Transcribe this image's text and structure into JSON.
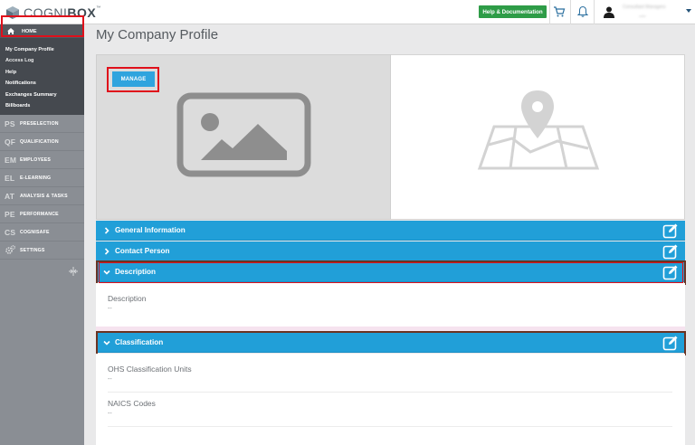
{
  "header": {
    "logo_prefix": "COGNI",
    "logo_suffix": "BOX",
    "logo_tm": "™",
    "help_label": "Help & Documentation",
    "icons": [
      "cart-icon",
      "bell-icon",
      "user-avatar-icon",
      "caret-down-icon"
    ],
    "user_name_blurred": "Consultant Managers",
    "user_sub_blurred": "user"
  },
  "sidebar": {
    "home_label": "HOME",
    "sub_items": [
      {
        "label": "My Company Profile"
      },
      {
        "label": "Access Log"
      },
      {
        "label": "Help"
      },
      {
        "label": "Notifications"
      },
      {
        "label": "Exchanges Summary"
      },
      {
        "label": "Billboards"
      }
    ],
    "nav_items": [
      {
        "abbr": "PS",
        "label": "PRESELECTION"
      },
      {
        "abbr": "QF",
        "label": "QUALIFICATION"
      },
      {
        "abbr": "EM",
        "label": "EMPLOYEES"
      },
      {
        "abbr": "EL",
        "label": "E-LEARNING"
      },
      {
        "abbr": "AT",
        "label": "ANALYSIS & TASKS"
      },
      {
        "abbr": "PE",
        "label": "PERFORMANCE"
      },
      {
        "abbr": "CS",
        "label": "COGNISAFE"
      },
      {
        "abbr": "",
        "label": "SETTINGS"
      }
    ]
  },
  "main": {
    "title": "My Company Profile",
    "manage_label": "MANAGE",
    "sections": [
      {
        "title": "General Information",
        "expanded": false
      },
      {
        "title": "Contact Person",
        "expanded": false
      },
      {
        "title": "Description",
        "expanded": true
      },
      {
        "title": "Classification",
        "expanded": true
      }
    ],
    "description": {
      "label": "Description",
      "value": "--"
    },
    "classification": {
      "fields": [
        {
          "label": "OHS Classification Units",
          "value": "--"
        },
        {
          "label": "NAICS Codes",
          "value": "--"
        }
      ]
    }
  },
  "colors": {
    "accent_blue": "#219fd8",
    "help_green": "#2e9c47",
    "highlight_red": "#e0101b",
    "sidebar_gray": "#8a8e94"
  }
}
